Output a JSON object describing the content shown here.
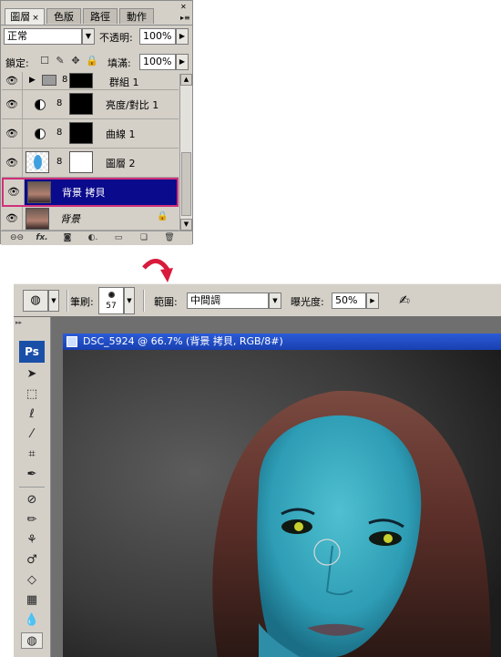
{
  "layers_panel": {
    "tabs": [
      "圖層",
      "色版",
      "路徑",
      "動作"
    ],
    "active_tab_close": "×",
    "blend_mode": "正常",
    "opacity_label": "不透明:",
    "opacity_value": "100%",
    "lock_label": "鎖定:",
    "fill_label": "填滿:",
    "fill_value": "100%",
    "layers": [
      {
        "name": "群組 1"
      },
      {
        "name": "亮度/對比 1"
      },
      {
        "name": "曲線 1"
      },
      {
        "name": "圖層 2"
      },
      {
        "name": "背景 拷貝"
      },
      {
        "name": "背景"
      }
    ]
  },
  "options_bar": {
    "brush_label": "筆刷:",
    "brush_size": "57",
    "range_label": "範圍:",
    "range_value": "中間調",
    "exposure_label": "曝光度:",
    "exposure_value": "50%"
  },
  "toolbox": {
    "logo": "Ps"
  },
  "document": {
    "title": "DSC_5924 @ 66.7% (背景 拷貝, RGB/8#)"
  },
  "colors": {
    "panel_bg": "#d4d0c8",
    "selected_layer": "#0a0a8c",
    "selection_border": "#d0307a",
    "title_bar": "#1f4fc8",
    "annotation_arrow": "#d81b3c"
  }
}
